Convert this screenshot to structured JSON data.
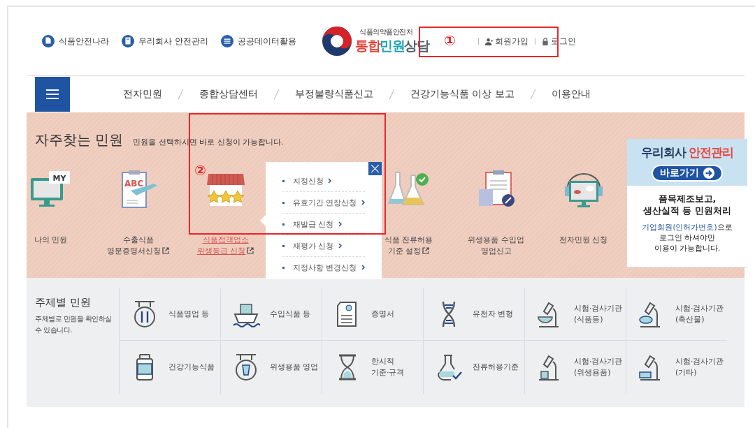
{
  "top_links": [
    {
      "label": "식품안전나라",
      "kind": "doc"
    },
    {
      "label": "우리회사 안전관리",
      "kind": "building"
    },
    {
      "label": "공공데이터활용",
      "kind": "list"
    }
  ],
  "logo": {
    "agency": "식품의약품안전처",
    "title_parts": [
      {
        "text": "통합",
        "color": "#e8423a"
      },
      {
        "text": "민원",
        "color": "#18a2b8"
      },
      {
        "text": "상담",
        "color": "#56606e"
      }
    ]
  },
  "account_links": [
    {
      "label": "회원가입",
      "kind": "join"
    },
    {
      "label": "로그인",
      "kind": "login"
    }
  ],
  "annotations": [
    "①",
    "②"
  ],
  "nav": {
    "items": [
      "전자민원",
      "종합상담센터",
      "부정불량식품신고",
      "건강기능식품 이상 보고",
      "이용안내"
    ]
  },
  "frequent": {
    "title": "자주찾는 민원",
    "subtitle": "민원을 선택하시면 바로 신청이 가능합니다.",
    "items": [
      {
        "kind": "my",
        "icon_text": "MY",
        "lines": [
          "나의 민원"
        ],
        "external": false,
        "selected": false
      },
      {
        "kind": "clipboard-plane",
        "icon_text": "ABC",
        "lines": [
          "수출식품",
          "영문증명서신청"
        ],
        "external": true,
        "selected": false
      },
      {
        "kind": "store",
        "lines": [
          "식품접객업소",
          "위생등급 신청"
        ],
        "external": true,
        "selected": true
      },
      {
        "kind": "flasks",
        "lines": [
          "식품 잔류허용",
          "기준 설정"
        ],
        "external": true,
        "selected": false
      },
      {
        "kind": "clipboard-pen",
        "lines": [
          "위생용품 수입업",
          "영업신고"
        ],
        "external": false,
        "selected": false
      },
      {
        "kind": "headset",
        "lines": [
          "전자민원 신청"
        ],
        "external": false,
        "selected": false
      }
    ]
  },
  "popup": {
    "items": [
      "지정신청",
      "유효기간 연장신청",
      "재발급 신청",
      "재평가 신청",
      "지정사항 변경신청"
    ]
  },
  "banner": {
    "title_parts": [
      {
        "text": "우리회사 ",
        "color": "#1f3559"
      },
      {
        "text": "안전관리",
        "color": "#e8423a"
      }
    ],
    "button": "바로가기",
    "heading_lines": [
      "품목제조보고,",
      "생산실적 등 민원처리"
    ],
    "note": {
      "highlight": "기업회원(인허가번호)",
      "lines": [
        "으로",
        "로그인 하셔야만",
        "이용이 가능합니다."
      ]
    }
  },
  "theme": {
    "title": "주제별 민원",
    "description": "주제별로 민원을 확인하실 수 있습니다.",
    "items": [
      {
        "kind": "restaurant",
        "lines": [
          "식품영업 등"
        ]
      },
      {
        "kind": "ship",
        "lines": [
          "수입식품 등"
        ]
      },
      {
        "kind": "certificate",
        "lines": [
          "증명서"
        ]
      },
      {
        "kind": "dna",
        "lines": [
          "유전자 변형"
        ]
      },
      {
        "kind": "micro-bowl",
        "lines": [
          "시험·검사기관",
          "(식품등)"
        ]
      },
      {
        "kind": "micro-chicken",
        "lines": [
          "시험·검사기관",
          "(축산물)"
        ]
      },
      {
        "kind": "jar",
        "lines": [
          "건강기능식품"
        ]
      },
      {
        "kind": "cup-sign",
        "lines": [
          "위생용품 영업"
        ]
      },
      {
        "kind": "hourglass",
        "lines": [
          "한시적",
          "기준·규격"
        ]
      },
      {
        "kind": "flask-check",
        "lines": [
          "잔류허용기준"
        ]
      },
      {
        "kind": "micro-cup",
        "lines": [
          "시험·검사기관",
          "(위생용품)"
        ]
      },
      {
        "kind": "micro-box",
        "lines": [
          "시험·검사기관",
          "(기타)"
        ]
      }
    ]
  }
}
